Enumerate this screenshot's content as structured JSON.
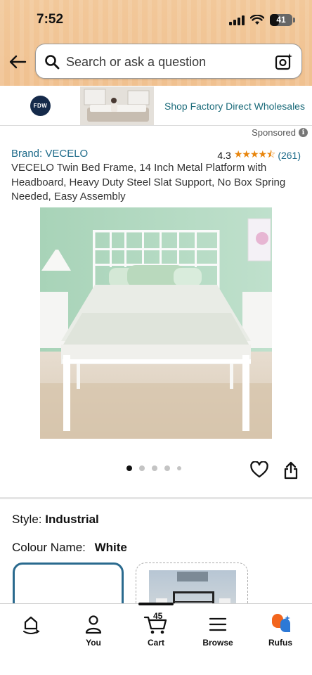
{
  "status_bar": {
    "time": "7:52",
    "battery": "41",
    "battery_level": 0.41
  },
  "search": {
    "placeholder": "Search or ask a question"
  },
  "sponsored_banner": {
    "logo_text": "FDW",
    "link_text": "Shop Factory Direct Wholesales"
  },
  "sponsored_label": "Sponsored",
  "product": {
    "brand": "Brand: VECELO",
    "rating": "4.3",
    "rating_stars": 4.3,
    "review_count": "(261)",
    "title": "VECELO Twin Bed Frame, 14 Inch Metal Platform with Headboard, Heavy Duty Steel Slat Support, No Box Spring Needed, Easy Assembly"
  },
  "image_dots": {
    "count": 5,
    "active_index": 0
  },
  "style": {
    "label": "Style:",
    "value": "Industrial"
  },
  "colour": {
    "label": "Colour Name:",
    "value": "White"
  },
  "tab_bar": {
    "tabs": [
      {
        "id": "home",
        "label": "",
        "icon": "home-icon"
      },
      {
        "id": "you",
        "label": "You",
        "icon": "person-icon"
      },
      {
        "id": "cart",
        "label": "Cart",
        "icon": "cart-icon",
        "badge": "45"
      },
      {
        "id": "browse",
        "label": "Browse",
        "icon": "menu-icon"
      },
      {
        "id": "rufus",
        "label": "Rufus",
        "icon": "rufus-icon"
      }
    ],
    "active": "cart"
  },
  "colors": {
    "accent_link": "#1e6b8a",
    "star": "#e8850c",
    "header_bg": "#f0c190",
    "selected_border": "#2a6a8e"
  }
}
